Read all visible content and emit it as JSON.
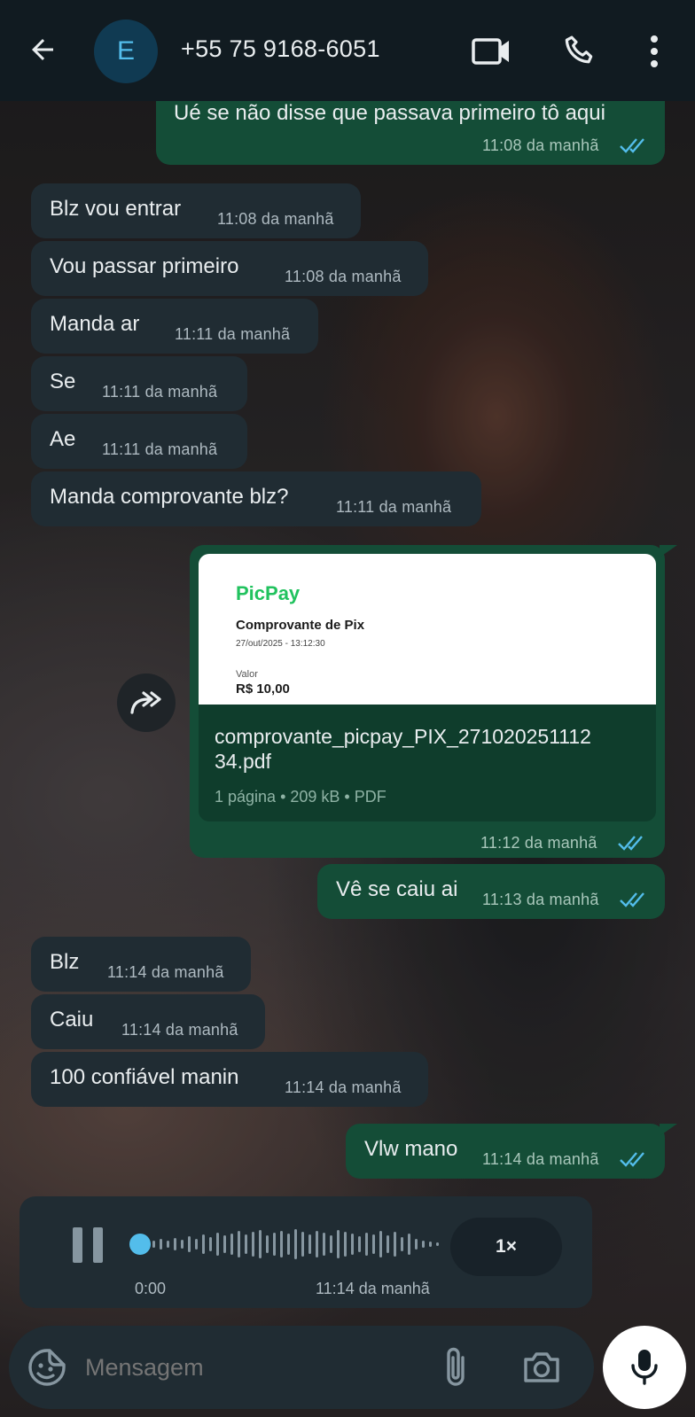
{
  "header": {
    "avatar_letter": "E",
    "contact": "+55 75 9168-6051"
  },
  "messages": [
    {
      "dir": "out",
      "text": "Ué se não disse que passava primeiro tô aqui",
      "time": "11:08 da manhã",
      "read": true
    },
    {
      "dir": "in",
      "text": "Blz vou entrar",
      "time": "11:08 da manhã"
    },
    {
      "dir": "in",
      "text": "Vou passar primeiro",
      "time": "11:08 da manhã"
    },
    {
      "dir": "in",
      "text": "Manda ar",
      "time": "11:11 da manhã"
    },
    {
      "dir": "in",
      "text": "Se",
      "time": "11:11 da manhã"
    },
    {
      "dir": "in",
      "text": "Ae",
      "time": "11:11 da manhã"
    },
    {
      "dir": "in",
      "text": "Manda comprovante blz?",
      "time": "11:11 da manhã"
    },
    {
      "dir": "out",
      "text": "Vê se caiu ai",
      "time": "11:13 da manhã",
      "read": true
    },
    {
      "dir": "in",
      "text": "Blz",
      "time": "11:14 da manhã"
    },
    {
      "dir": "in",
      "text": "Caiu",
      "time": "11:14 da manhã"
    },
    {
      "dir": "in",
      "text": "100 confiável manin",
      "time": "11:14 da manhã"
    },
    {
      "dir": "out",
      "text": "Vlw mano",
      "time": "11:14 da manhã",
      "read": true
    }
  ],
  "document": {
    "brand": "PicPay",
    "preview_title": "Comprovante de Pix",
    "preview_date": "27/out/2025 - 13:12:30",
    "value_label": "Valor",
    "value": "R$ 10,00",
    "filename_line1": "comprovante_picpay_PIX_271020251112",
    "filename_line2": "34.pdf",
    "meta": "1 página • 209 kB • PDF",
    "time": "11:12 da manhã",
    "read": true
  },
  "voice": {
    "elapsed": "0:00",
    "time": "11:14 da manhã",
    "speed": "1×",
    "progress": 0
  },
  "input": {
    "placeholder": "Mensagem"
  },
  "colors": {
    "incoming": "#202c33",
    "outgoing": "#144d37",
    "read_tick": "#53bdeb",
    "brand_picpay": "#21c25e"
  }
}
